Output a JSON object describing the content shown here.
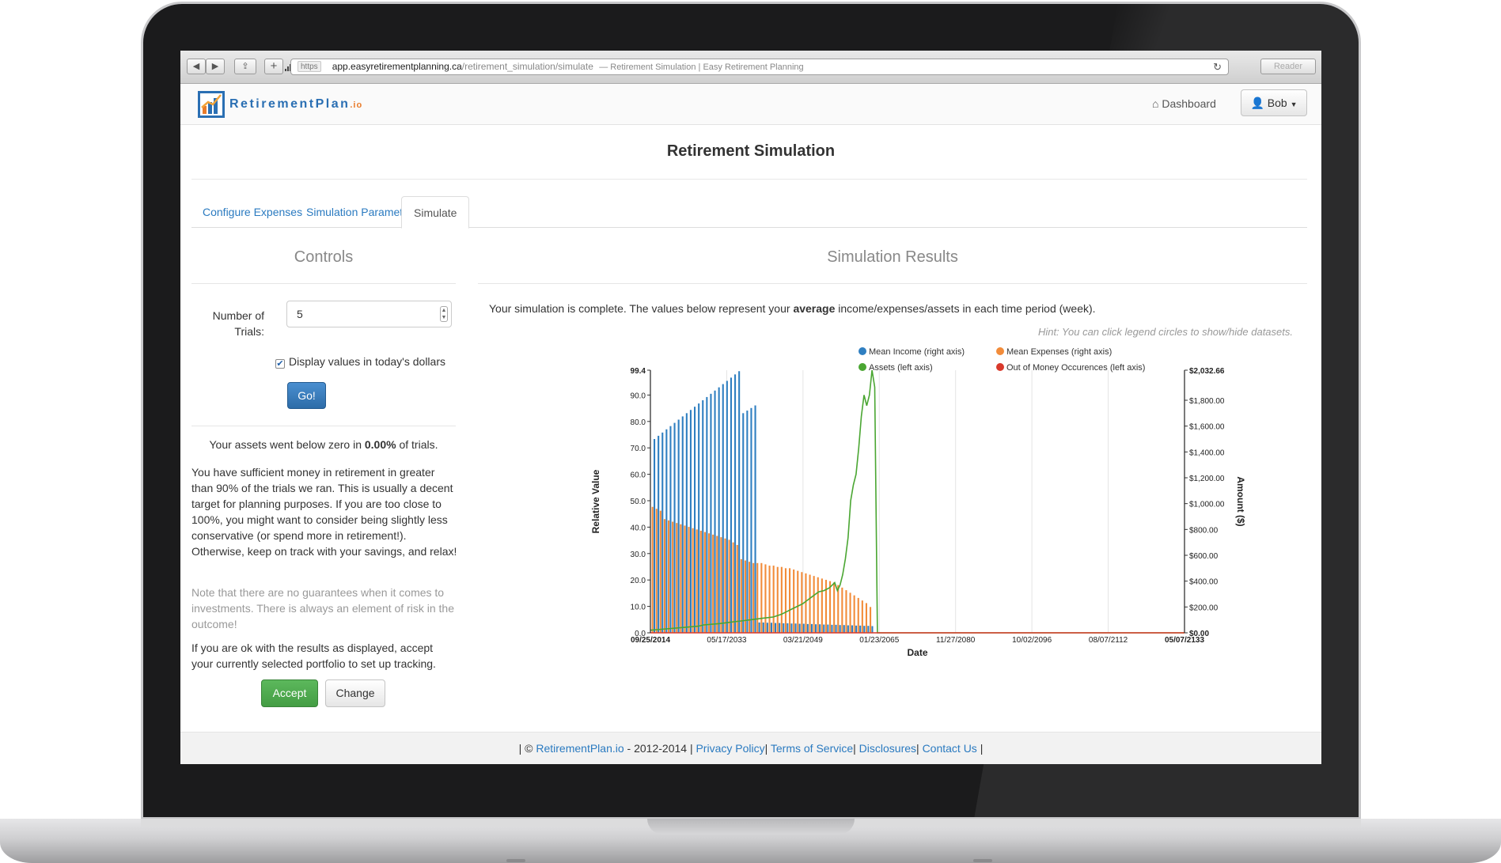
{
  "browser": {
    "nav_back": "◀",
    "nav_forward": "▶",
    "share": "⇪",
    "new_tab": "+",
    "protocol": "https",
    "domain": "app.easyretirementplanning.ca",
    "path": "/retirement_simulation/simulate",
    "page_title": "— Retirement Simulation | Easy Retirement Planning",
    "reader_label": "Reader"
  },
  "navbar": {
    "logo_main": "RetirementPlan",
    "logo_suffix": ".io",
    "dashboard_label": "Dashboard",
    "user_label": "Bob"
  },
  "page": {
    "title": "Retirement Simulation"
  },
  "tabs": [
    {
      "label": "Configure Expenses",
      "active": false
    },
    {
      "label": "Simulation Parameters",
      "active": false
    },
    {
      "label": "Simulate",
      "active": true
    }
  ],
  "controls": {
    "heading": "Controls",
    "trials_label": "Number of Trials:",
    "trials_value": "5",
    "todays_dollars_label": "Display values in today's dollars",
    "todays_dollars_checked": true,
    "go_label": "Go!",
    "assets_prefix": "Your assets went below zero in",
    "assets_percent": "0.00%",
    "assets_suffix": "of trials.",
    "summary": "You have sufficient money in retirement in greater than 90% of the trials we ran. This is usually a decent target for planning purposes. If you are too close to 100%, you might want to consider being slightly less conservative (or spend more in retirement!). Otherwise, keep on track with your savings, and relax!",
    "disclaimer": "Note that there are no guarantees when it comes to investments. There is always an element of risk in the outcome!",
    "accept_text": "If you are ok with the results as displayed, accept your currently selected portfolio to set up tracking.",
    "accept_label": "Accept",
    "change_label": "Change"
  },
  "results": {
    "heading": "Simulation Results",
    "intro_prefix": "Your simulation is complete. The values below represent your",
    "intro_bold": "average",
    "intro_suffix": "income/expenses/assets in each time period (week).",
    "hint": "Hint: You can click legend circles to show/hide datasets."
  },
  "footer": {
    "copyright_prefix": "| ©",
    "brand_link": "RetirementPlan.io",
    "years": "- 2012-2014 |",
    "links": [
      "Privacy Policy",
      "Terms of Service",
      "Disclosures",
      "Contact Us"
    ],
    "sep": "|"
  },
  "colors": {
    "income": "#2f7fc1",
    "expenses": "#f28c3a",
    "assets": "#4aa632",
    "out_of_money": "#d9392b"
  },
  "chart_data": {
    "type": "bar",
    "xlabel": "Date",
    "ylabel_left": "Relative Value",
    "ylabel_right": "Amount ($)",
    "ylim_left": [
      0,
      99.4
    ],
    "ylim_right": [
      0,
      2032.66
    ],
    "x_tick_labels": [
      "09/25/2014",
      "05/17/2033",
      "03/21/2049",
      "01/23/2065",
      "11/27/2080",
      "10/02/2096",
      "08/07/2112",
      "05/07/2133"
    ],
    "y_left_ticks": [
      "0.0",
      "10.0",
      "20.0",
      "30.0",
      "40.0",
      "50.0",
      "60.0",
      "70.0",
      "80.0",
      "90.0",
      "99.4"
    ],
    "y_right_ticks": [
      "$0.00",
      "$200.00",
      "$400.00",
      "$600.00",
      "$800.00",
      "$1,000.00",
      "$1,200.00",
      "$1,400.00",
      "$1,600.00",
      "$1,800.00",
      "$2,032.66"
    ],
    "grid": true,
    "legend_position": "top",
    "series": [
      {
        "name": "Mean Income (right axis)",
        "axis": "right",
        "kind": "bar",
        "values": [
          1500,
          1525,
          1550,
          1575,
          1600,
          1625,
          1650,
          1675,
          1700,
          1725,
          1750,
          1775,
          1800,
          1825,
          1850,
          1875,
          1900,
          1925,
          1950,
          1975,
          2000,
          2025,
          1700,
          1720,
          1740,
          1760,
          80,
          80,
          78,
          78,
          76,
          76,
          74,
          74,
          72,
          72,
          70,
          70,
          68,
          68,
          66,
          66,
          64,
          64,
          62,
          62,
          60,
          60,
          58,
          58,
          56,
          56,
          54,
          54,
          52,
          0,
          0,
          0,
          0,
          0,
          0,
          0,
          0,
          0,
          0,
          0,
          0
        ]
      },
      {
        "name": "Mean Expenses (right axis)",
        "axis": "right",
        "kind": "bar",
        "values": [
          975,
          960,
          945,
          880,
          870,
          860,
          850,
          840,
          830,
          820,
          810,
          800,
          790,
          780,
          770,
          760,
          750,
          740,
          730,
          720,
          700,
          680,
          570,
          560,
          550,
          540,
          540,
          540,
          530,
          520,
          520,
          510,
          510,
          500,
          500,
          490,
          480,
          470,
          460,
          450,
          440,
          430,
          420,
          410,
          400,
          390,
          370,
          350,
          330,
          310,
          290,
          270,
          250,
          230,
          200,
          0,
          0,
          0,
          0,
          0,
          0,
          0,
          0,
          0,
          0,
          0,
          0
        ]
      },
      {
        "name": "Assets (left axis)",
        "axis": "left",
        "kind": "line",
        "values": [
          1.0,
          1.5,
          2.0,
          2.5,
          3.0,
          3.5,
          4.0,
          4.5,
          5.0,
          5.5,
          6.0,
          7.0,
          8.0,
          9.0,
          10.0,
          11.0,
          12.5,
          14.0,
          15.5,
          16.0,
          16.5,
          17.0,
          18.0,
          19.0,
          16.0,
          18.0,
          22.0,
          28.0,
          36.0,
          50.0,
          56.0,
          60.0,
          70.0,
          82.0,
          90.0,
          86.0,
          90.0,
          99.4,
          93.0,
          0.0,
          0.0,
          0.0,
          0.0
        ],
        "x_fraction": [
          0.0,
          0.03,
          0.06,
          0.09,
          0.1,
          0.13,
          0.15,
          0.17,
          0.19,
          0.21,
          0.23,
          0.245,
          0.255,
          0.265,
          0.275,
          0.285,
          0.295,
          0.305,
          0.315,
          0.325,
          0.33,
          0.335,
          0.34,
          0.345,
          0.35,
          0.355,
          0.36,
          0.365,
          0.37,
          0.375,
          0.38,
          0.385,
          0.39,
          0.395,
          0.4,
          0.405,
          0.41,
          0.415,
          0.42,
          0.425,
          0.43,
          0.5,
          1.0
        ]
      },
      {
        "name": "Out of Money Occurences (left axis)",
        "axis": "left",
        "kind": "line",
        "values": [
          0.0,
          0.0
        ]
      }
    ]
  }
}
